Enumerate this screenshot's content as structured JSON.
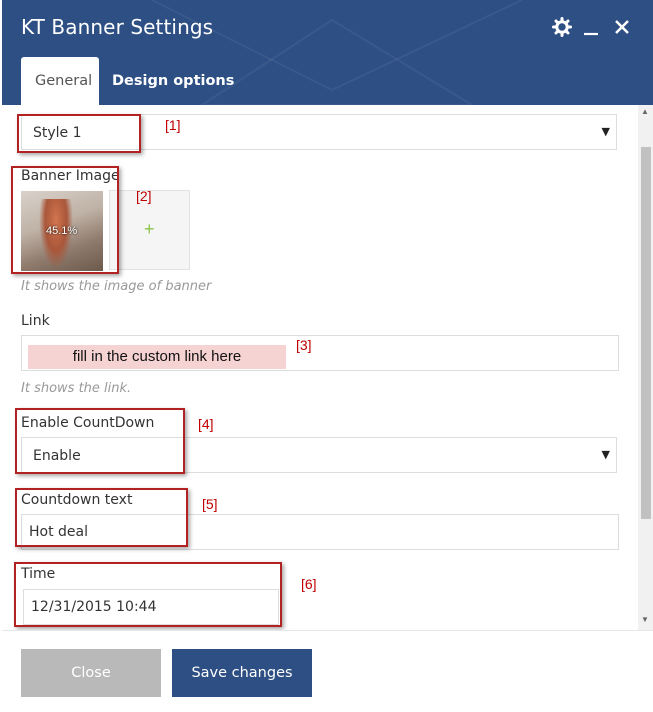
{
  "window": {
    "title": "KT Banner Settings",
    "icons": {
      "settings": "gear-icon",
      "minimize": "minimize-icon",
      "close": "close-icon"
    }
  },
  "tabs": [
    {
      "label": "General",
      "active": true
    },
    {
      "label": "Design options",
      "active": false
    }
  ],
  "fields": {
    "style": {
      "value": "Style 1"
    },
    "banner_image": {
      "label": "Banner Image",
      "upload_percent": "45.1%",
      "help": "It shows the image of banner",
      "add_symbol": "+"
    },
    "link": {
      "label": "Link",
      "value": "fill in the custom link here",
      "help": "It shows the link."
    },
    "enable_countdown": {
      "label": "Enable CountDown",
      "value": "Enable"
    },
    "countdown_text": {
      "label": "Countdown text",
      "value": "Hot deal"
    },
    "time": {
      "label": "Time",
      "value": "12/31/2015 10:44"
    }
  },
  "annotations": [
    "[1]",
    "[2]",
    "[3]",
    "[4]",
    "[5]",
    "[6]"
  ],
  "footer": {
    "close_label": "Close",
    "save_label": "Save changes"
  },
  "colors": {
    "header": "#2d4f84",
    "save_button": "#2d4f84",
    "close_button": "#b9b9b9",
    "callout": "#b22222",
    "note": "#c00000",
    "highlight": "#f6d3d3"
  }
}
